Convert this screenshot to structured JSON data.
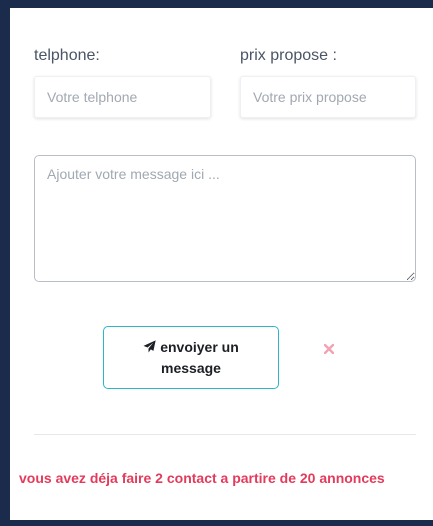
{
  "form": {
    "telephone": {
      "label": "telphone:",
      "placeholder": "Votre telphone",
      "value": ""
    },
    "prix": {
      "label": "prix propose :",
      "placeholder": "Votre prix propose",
      "value": ""
    },
    "message": {
      "placeholder": "Ajouter votre message ici ...",
      "value": ""
    },
    "send_button": {
      "label": "envoiyer un message",
      "icon": "paper-plane-icon"
    },
    "close_icon": "close-icon"
  },
  "notice": {
    "text": "vous avez déja faire 2 contact a partire de 20 annonces"
  },
  "colors": {
    "page_background": "#1b2b4b",
    "button_border": "#2bb7c9",
    "close_icon": "#f1a3b4",
    "notice_text": "#e23b5c"
  }
}
